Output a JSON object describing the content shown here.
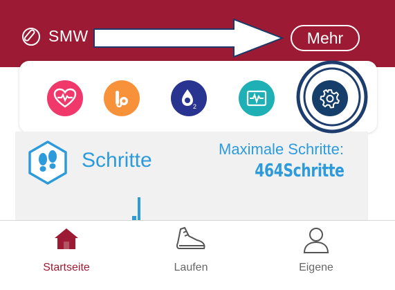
{
  "header": {
    "device_name": "SMW",
    "more_label": "Mehr",
    "icon": "watch-icon",
    "background": "#9c1a33"
  },
  "quick_actions": [
    {
      "name": "heart-rate",
      "icon": "heart-pulse-icon",
      "color": "#f0386b"
    },
    {
      "name": "blood-pressure",
      "icon": "blood-pressure-icon",
      "color": "#f7923a"
    },
    {
      "name": "blood-oxygen",
      "icon": "oxygen-drop-icon",
      "color": "#28348f"
    },
    {
      "name": "ecg",
      "icon": "ecg-monitor-icon",
      "color": "#1eb0b4"
    },
    {
      "name": "settings",
      "icon": "gear-icon",
      "color": "#163e6b"
    }
  ],
  "steps": {
    "title": "Schritte",
    "max_label": "Maximale Schritte:",
    "max_value": "464Schritte",
    "accent": "#2d9bdb"
  },
  "tabs": [
    {
      "label": "Startseite",
      "icon": "home-icon",
      "active": true
    },
    {
      "label": "Laufen",
      "icon": "running-shoe-icon",
      "active": false
    },
    {
      "label": "Eigene",
      "icon": "user-icon",
      "active": false
    }
  ]
}
